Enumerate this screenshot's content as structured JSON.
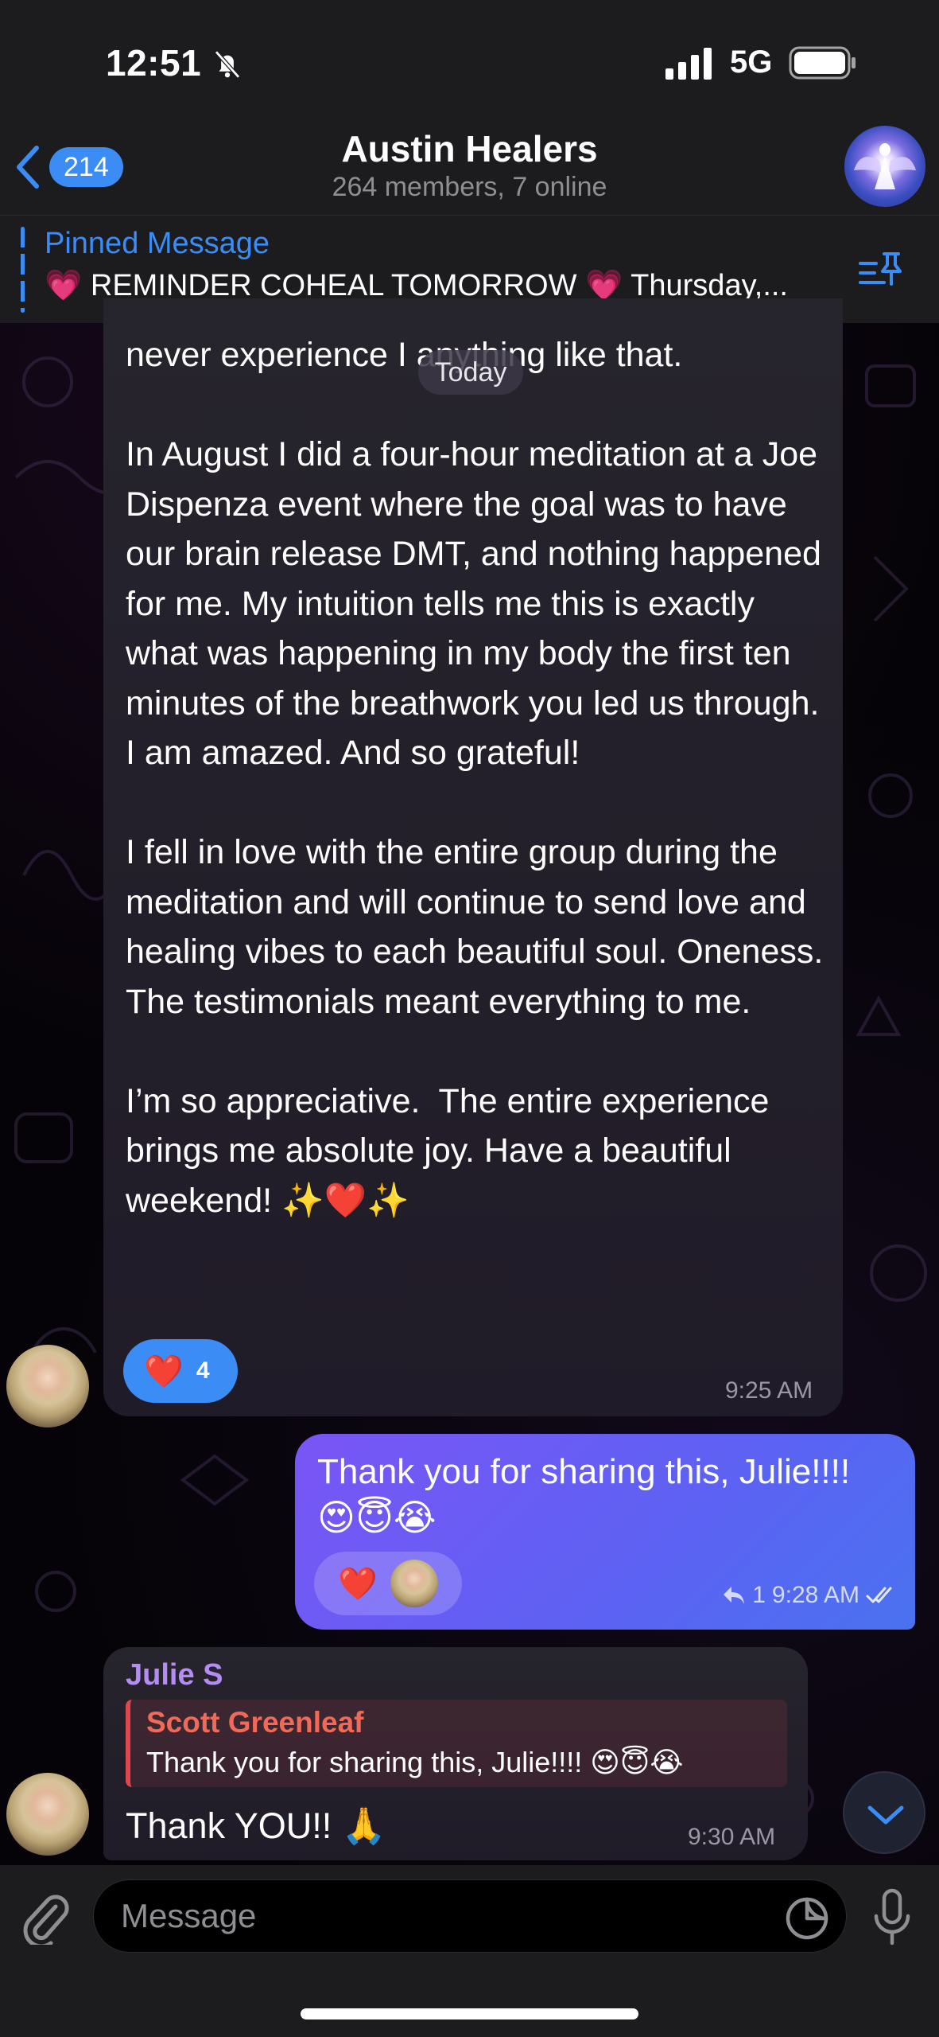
{
  "status_bar": {
    "time": "12:51",
    "network": "5G"
  },
  "header": {
    "back_count": "214",
    "title": "Austin Healers",
    "subtitle": "264 members, 7 online"
  },
  "pinned": {
    "title": "Pinned Message",
    "text": "💗 REMINDER COHEAL TOMORROW 💗 Thursday,..."
  },
  "date_separator": "Today",
  "messages": [
    {
      "text": "never experience I anything like that.\n\nIn August I did a four-hour meditation at a Joe Dispenza event where the goal was to have our brain release DMT, and nothing happened for me. My intuition tells me this is exactly what was happening in my body the first ten minutes of the breathwork you led us through. I am amazed. And so grateful!\n\nI fell in love with the entire group during the meditation and will continue to send love and healing vibes to each beautiful soul. Oneness. The testimonials meant everything to me.\n\nI’m so appreciative.  The entire experience brings me absolute joy. Have a beautiful weekend! ✨❤️✨",
      "reaction_emoji": "❤️",
      "reaction_count": "4",
      "time": "9:25 AM"
    },
    {
      "text": "Thank you for sharing this, Julie!!!!",
      "emoji": "😍😇😭",
      "reaction_emoji": "❤️",
      "reply_count": "1",
      "time": "9:28 AM"
    },
    {
      "sender": "Julie S",
      "quote_name": "Scott Greenleaf",
      "quote_text": "Thank you for sharing this, Julie!!!! 😍😇😭",
      "text": "Thank YOU!! 🙏",
      "time": "9:30 AM"
    }
  ],
  "input": {
    "placeholder": "Message"
  },
  "colors": {
    "accent": "#3b8cf5",
    "outgoing_bubble": "#6a5cf4",
    "incoming_bubble": "#25222c",
    "sender_name": "#b48cf2",
    "quote_name": "#f06a5a"
  }
}
